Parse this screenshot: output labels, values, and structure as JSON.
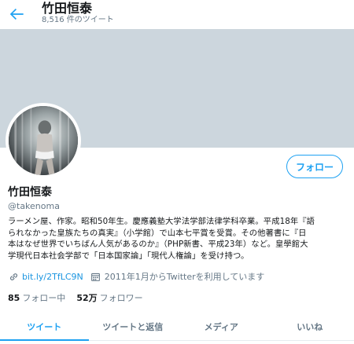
{
  "header": {
    "title": "竹田恒泰",
    "tweet_count": "8,516 件のツイート",
    "back_icon": "back-arrow-icon"
  },
  "profile": {
    "name": "竹田恒泰",
    "handle": "@takenoma",
    "follow_label": "フォロー",
    "bio_lines": [
      "ラーメン屋、作家。昭和50年生。慶應義塾大学法学部法律学科卒業。平成18年『語",
      "られなかった皇族たちの真実』（小学館）で山本七平賞を受賞。その他著書に『日",
      "本はなぜ世界でいちばん人気があるのか』（PHP新書、平成23年）など。皇學館大",
      "学現代日本社会学部で「日本国家論」「現代人権論」を受け持つ。"
    ],
    "link": "bit.ly/2TfLC9N",
    "joined": "2011年1月からTwitterを利用しています",
    "following_count": "85",
    "following_label": "フォロー中",
    "followers_count": "52万",
    "followers_label": "フォロワー"
  },
  "tabs": [
    {
      "label": "ツイート",
      "active": true
    },
    {
      "label": "ツイートと返信",
      "active": false
    },
    {
      "label": "メディア",
      "active": false
    },
    {
      "label": "いいね",
      "active": false
    }
  ],
  "colors": {
    "accent": "#1da1f2",
    "link": "#1b95e0",
    "banner": "#ccd6dd",
    "muted": "#657786"
  }
}
